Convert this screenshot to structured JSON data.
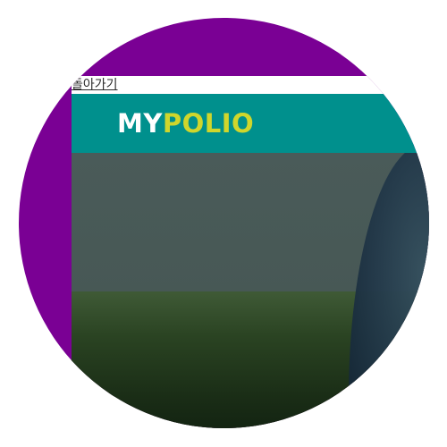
{
  "page": {
    "back_link": "돌아가기",
    "logo": {
      "part1": "MY",
      "part2": "POLIO"
    }
  },
  "colors": {
    "frame_bg": "#7a0094",
    "header_bg": "#00908d",
    "logo_part1": "#ffffff",
    "logo_part2": "#cfd62c"
  }
}
